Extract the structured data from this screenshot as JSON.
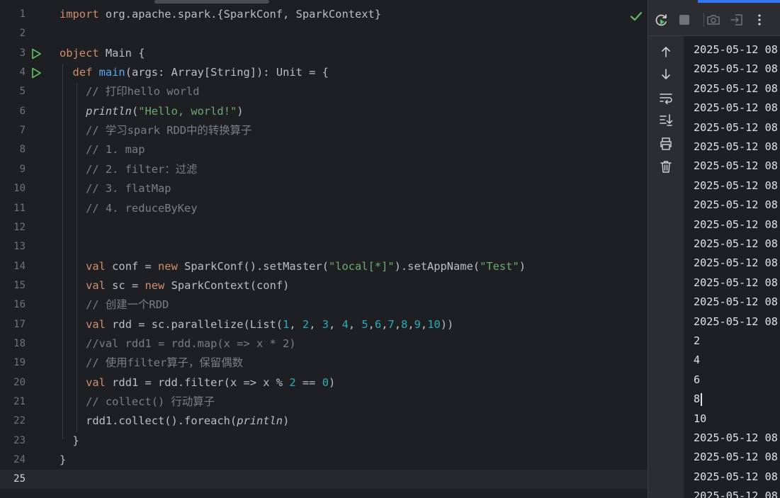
{
  "editor": {
    "lines": [
      {
        "number": "1",
        "tokens": [
          {
            "t": "import ",
            "c": "kw"
          },
          {
            "t": "org.apache.spark.{SparkConf, SparkContext}",
            "c": ""
          }
        ]
      },
      {
        "number": "2",
        "tokens": []
      },
      {
        "number": "3",
        "run": true,
        "tokens": [
          {
            "t": "object ",
            "c": "kw"
          },
          {
            "t": "Main {",
            "c": ""
          }
        ]
      },
      {
        "number": "4",
        "run": true,
        "tokens": [
          {
            "t": "  ",
            "c": ""
          },
          {
            "t": "def ",
            "c": "kw"
          },
          {
            "t": "main",
            "c": "fn"
          },
          {
            "t": "(args: Array[String]): Unit = {",
            "c": ""
          }
        ]
      },
      {
        "number": "5",
        "tokens": [
          {
            "t": "    // 打印hello world",
            "c": "cm"
          }
        ]
      },
      {
        "number": "6",
        "tokens": [
          {
            "t": "    ",
            "c": ""
          },
          {
            "t": "println",
            "c": "it"
          },
          {
            "t": "(",
            "c": ""
          },
          {
            "t": "\"Hello, world!\"",
            "c": "str"
          },
          {
            "t": ")",
            "c": ""
          }
        ]
      },
      {
        "number": "7",
        "tokens": [
          {
            "t": "    // 学习spark RDD中的转换算子",
            "c": "cm"
          }
        ]
      },
      {
        "number": "8",
        "tokens": [
          {
            "t": "    // 1. map",
            "c": "cm"
          }
        ]
      },
      {
        "number": "9",
        "tokens": [
          {
            "t": "    // 2. filter：过滤",
            "c": "cm"
          }
        ]
      },
      {
        "number": "10",
        "tokens": [
          {
            "t": "    // 3. flatMap",
            "c": "cm"
          }
        ]
      },
      {
        "number": "11",
        "tokens": [
          {
            "t": "    // 4. reduceByKey",
            "c": "cm"
          }
        ]
      },
      {
        "number": "12",
        "tokens": []
      },
      {
        "number": "13",
        "tokens": []
      },
      {
        "number": "14",
        "tokens": [
          {
            "t": "    ",
            "c": ""
          },
          {
            "t": "val ",
            "c": "kw"
          },
          {
            "t": "conf = ",
            "c": ""
          },
          {
            "t": "new ",
            "c": "kw"
          },
          {
            "t": "SparkConf().setMaster(",
            "c": ""
          },
          {
            "t": "\"local[*]\"",
            "c": "str"
          },
          {
            "t": ").setAppName(",
            "c": ""
          },
          {
            "t": "\"Test\"",
            "c": "str"
          },
          {
            "t": ")",
            "c": ""
          }
        ]
      },
      {
        "number": "15",
        "tokens": [
          {
            "t": "    ",
            "c": ""
          },
          {
            "t": "val ",
            "c": "kw"
          },
          {
            "t": "sc = ",
            "c": ""
          },
          {
            "t": "new ",
            "c": "kw"
          },
          {
            "t": "SparkContext(conf)",
            "c": ""
          }
        ]
      },
      {
        "number": "16",
        "tokens": [
          {
            "t": "    // 创建一个RDD",
            "c": "cm"
          }
        ]
      },
      {
        "number": "17",
        "tokens": [
          {
            "t": "    ",
            "c": ""
          },
          {
            "t": "val ",
            "c": "kw"
          },
          {
            "t": "rdd = sc.parallelize(List(",
            "c": ""
          },
          {
            "t": "1",
            "c": "num"
          },
          {
            "t": ", ",
            "c": ""
          },
          {
            "t": "2",
            "c": "num"
          },
          {
            "t": ", ",
            "c": ""
          },
          {
            "t": "3",
            "c": "num"
          },
          {
            "t": ", ",
            "c": ""
          },
          {
            "t": "4",
            "c": "num"
          },
          {
            "t": ", ",
            "c": ""
          },
          {
            "t": "5",
            "c": "num"
          },
          {
            "t": ",",
            "c": ""
          },
          {
            "t": "6",
            "c": "num"
          },
          {
            "t": ",",
            "c": ""
          },
          {
            "t": "7",
            "c": "num"
          },
          {
            "t": ",",
            "c": ""
          },
          {
            "t": "8",
            "c": "num"
          },
          {
            "t": ",",
            "c": ""
          },
          {
            "t": "9",
            "c": "num"
          },
          {
            "t": ",",
            "c": ""
          },
          {
            "t": "10",
            "c": "num"
          },
          {
            "t": "))",
            "c": ""
          }
        ]
      },
      {
        "number": "18",
        "tokens": [
          {
            "t": "    //val rdd1 = rdd.map(x => x * 2)",
            "c": "cm"
          }
        ]
      },
      {
        "number": "19",
        "tokens": [
          {
            "t": "    // 使用filter算子，保留偶数",
            "c": "cm"
          }
        ]
      },
      {
        "number": "20",
        "tokens": [
          {
            "t": "    ",
            "c": ""
          },
          {
            "t": "val ",
            "c": "kw"
          },
          {
            "t": "rdd1 = rdd.filter(x => x % ",
            "c": ""
          },
          {
            "t": "2",
            "c": "num"
          },
          {
            "t": " == ",
            "c": ""
          },
          {
            "t": "0",
            "c": "num"
          },
          {
            "t": ")",
            "c": ""
          }
        ]
      },
      {
        "number": "21",
        "tokens": [
          {
            "t": "    // collect() 行动算子",
            "c": "cm"
          }
        ]
      },
      {
        "number": "22",
        "tokens": [
          {
            "t": "    rdd1.collect().foreach(",
            "c": ""
          },
          {
            "t": "println",
            "c": "it"
          },
          {
            "t": ")",
            "c": ""
          }
        ]
      },
      {
        "number": "23",
        "tokens": [
          {
            "t": "  }",
            "c": ""
          }
        ]
      },
      {
        "number": "24",
        "tokens": [
          {
            "t": "}",
            "c": ""
          }
        ]
      },
      {
        "number": "25",
        "current": true,
        "tokens": []
      }
    ]
  },
  "console": {
    "lines": [
      "2025-05-12 08",
      "2025-05-12 08",
      "2025-05-12 08",
      "2025-05-12 08",
      "2025-05-12 08",
      "2025-05-12 08",
      "2025-05-12 08",
      "2025-05-12 08",
      "2025-05-12 08",
      "2025-05-12 08",
      "2025-05-12 08",
      "2025-05-12 08",
      "2025-05-12 08",
      "2025-05-12 08",
      "2025-05-12 08",
      "2",
      "4",
      "6",
      "8",
      "10",
      "2025-05-12 08",
      "2025-05-12 08",
      "2025-05-12 08",
      "2025-05-12 08"
    ],
    "caret_line": 18
  },
  "colors": {
    "background": "#1e1f22",
    "keyword": "#cf8e6d",
    "function": "#56a8f5",
    "string": "#6aab73",
    "number": "#2aacb8",
    "comment": "#7a7e85",
    "run_green": "#5fb865",
    "accent": "#3574f0"
  },
  "icons": {
    "status": "check-icon",
    "gutter": "run-icon",
    "top_toolbar": [
      "rerun-icon",
      "stop-icon",
      "camera-icon",
      "exit-icon",
      "more-icon"
    ],
    "side_toolbar": [
      "arrow-up-icon",
      "arrow-down-icon",
      "soft-wrap-icon",
      "scroll-to-end-icon",
      "print-icon",
      "trash-icon"
    ]
  }
}
